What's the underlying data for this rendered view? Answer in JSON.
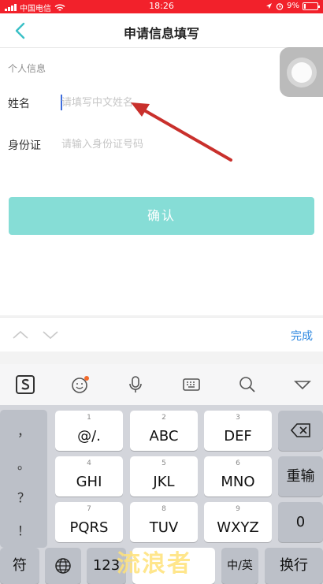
{
  "status_bar": {
    "carrier": "中国电信",
    "time": "18:26",
    "battery_percent": "9%"
  },
  "nav": {
    "title": "申请信息填写"
  },
  "form": {
    "section_label": "个人信息",
    "name_label": "姓名",
    "name_placeholder": "请填写中文姓名",
    "id_label": "身份证",
    "id_placeholder": "请输入身份证号码",
    "confirm_label": "确认"
  },
  "accessory": {
    "done_label": "完成"
  },
  "keyboard": {
    "toolbar_icons": [
      "sogou-icon",
      "emoji-icon",
      "microphone-icon",
      "keyboard-icon",
      "search-icon",
      "collapse-icon"
    ],
    "symbols": [
      "，",
      "。",
      "？",
      "！"
    ],
    "keys": [
      {
        "sub": "1",
        "main": "@/."
      },
      {
        "sub": "2",
        "main": "ABC"
      },
      {
        "sub": "3",
        "main": "DEF"
      },
      {
        "sub": "4",
        "main": "GHI"
      },
      {
        "sub": "5",
        "main": "JKL"
      },
      {
        "sub": "6",
        "main": "MNO"
      },
      {
        "sub": "7",
        "main": "PQRS"
      },
      {
        "sub": "8",
        "main": "TUV"
      },
      {
        "sub": "9",
        "main": "WXYZ"
      }
    ],
    "retype_label": "重输",
    "zero_label": "0",
    "symbol_key_label": "符",
    "num_key_label": "123",
    "lang_key_label": "中/英",
    "return_label": "换行"
  },
  "watermark": "流浪者",
  "colors": {
    "status_bar": "#f2212b",
    "confirm_button": "#86ddd6",
    "back_arrow": "#3ac0c6",
    "done_text": "#2e88e0",
    "annotation_arrow": "#c9302c"
  }
}
